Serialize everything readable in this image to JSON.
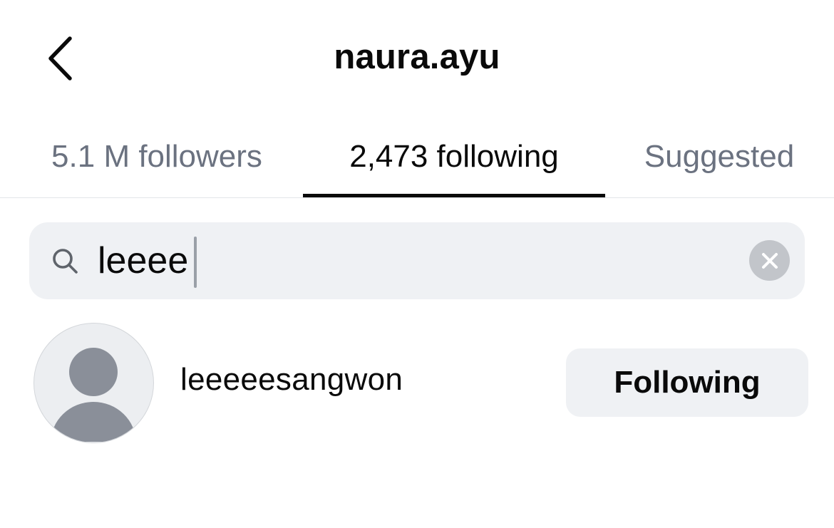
{
  "header": {
    "title": "naura.ayu",
    "back_icon": "chevron-left-icon"
  },
  "tabs": [
    {
      "label": "5.1 M followers",
      "active": false
    },
    {
      "label": "2,473 following",
      "active": true
    },
    {
      "label": "Suggested",
      "active": false
    }
  ],
  "search": {
    "value": "leeee",
    "search_icon": "search-icon",
    "clear_icon": "clear-icon"
  },
  "results": [
    {
      "username": "leeeeesangwon",
      "avatar_icon": "default-avatar-icon",
      "button_label": "Following"
    }
  ],
  "colors": {
    "text_primary": "#0a0a0a",
    "text_secondary": "#6b7280",
    "surface": "#eff1f4",
    "clear_button": "#c2c5ca",
    "avatar_silhouette": "#8a8f99"
  }
}
